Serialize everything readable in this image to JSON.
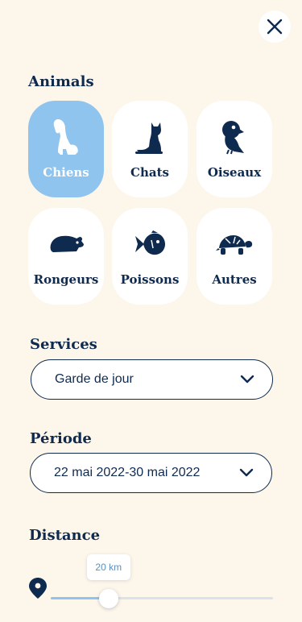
{
  "close": {
    "icon": "close-icon"
  },
  "animals": {
    "title": "Animals",
    "items": [
      {
        "label": "Chiens",
        "icon": "dog-icon",
        "selected": true
      },
      {
        "label": "Chats",
        "icon": "cat-icon",
        "selected": false
      },
      {
        "label": "Oiseaux",
        "icon": "bird-icon",
        "selected": false
      },
      {
        "label": "Rongeurs",
        "icon": "rodent-icon",
        "selected": false
      },
      {
        "label": "Poissons",
        "icon": "fish-icon",
        "selected": false
      },
      {
        "label": "Autres",
        "icon": "turtle-icon",
        "selected": false
      }
    ]
  },
  "services": {
    "title": "Services",
    "value": "Garde de jour"
  },
  "periode": {
    "title": "Période",
    "value": "22 mai 2022-30 mai 2022"
  },
  "distance": {
    "title": "Distance",
    "value_label": "20 km",
    "fraction": 0.26,
    "icon": "map-pin-icon"
  },
  "colors": {
    "background": "#fdf6eb",
    "navy": "#0f2a4f",
    "selected_tile": "#8fc4ee",
    "tile": "#ffffff"
  }
}
